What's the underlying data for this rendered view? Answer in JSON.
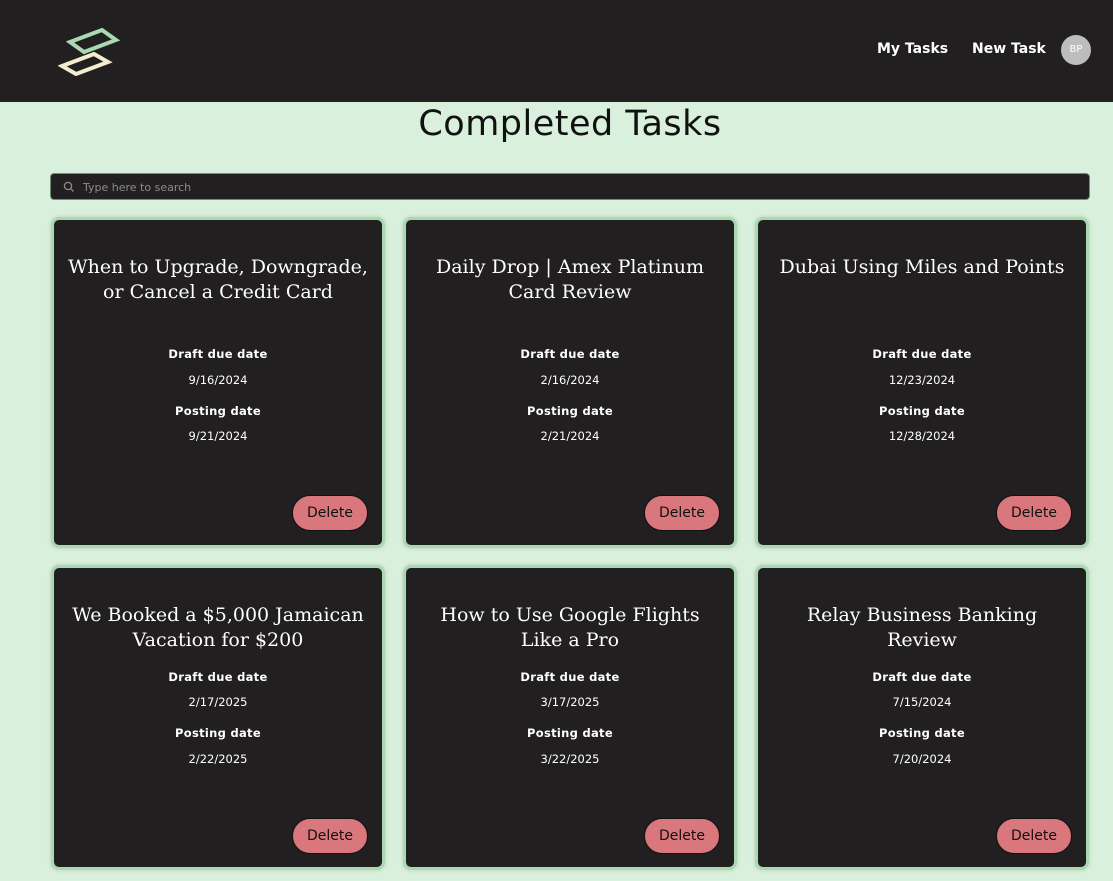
{
  "nav": {
    "my_tasks": "My Tasks",
    "new_task": "New Task",
    "avatar_initials": "BP"
  },
  "page": {
    "title": "Completed Tasks"
  },
  "search": {
    "placeholder": "Type here to search",
    "value": ""
  },
  "labels": {
    "draft_due": "Draft due date",
    "posting": "Posting date",
    "delete": "Delete"
  },
  "cards": [
    {
      "title": "When to Upgrade, Downgrade, or Cancel a Credit Card",
      "draft_due": "9/16/2024",
      "posting": "9/21/2024"
    },
    {
      "title": "Daily Drop | Amex Platinum Card Review",
      "draft_due": "2/16/2024",
      "posting": "2/21/2024"
    },
    {
      "title": "Dubai Using Miles and Points",
      "draft_due": "12/23/2024",
      "posting": "12/28/2024"
    },
    {
      "title": "We Booked a $5,000 Jamaican Vacation for $200",
      "draft_due": "2/17/2025",
      "posting": "2/22/2025"
    },
    {
      "title": "How to Use Google Flights Like a Pro",
      "draft_due": "3/17/2025",
      "posting": "3/22/2025"
    },
    {
      "title": "Relay Business Banking Review",
      "draft_due": "7/15/2024",
      "posting": "7/20/2024"
    }
  ],
  "colors": {
    "nav_bg": "#211f20",
    "page_bg": "#d8f0dc",
    "card_bg": "#211f20",
    "card_border": "#a9d8b1",
    "delete_bg": "#d9777c"
  },
  "icons": {
    "logo": "logo-icon",
    "search": "search-icon"
  }
}
